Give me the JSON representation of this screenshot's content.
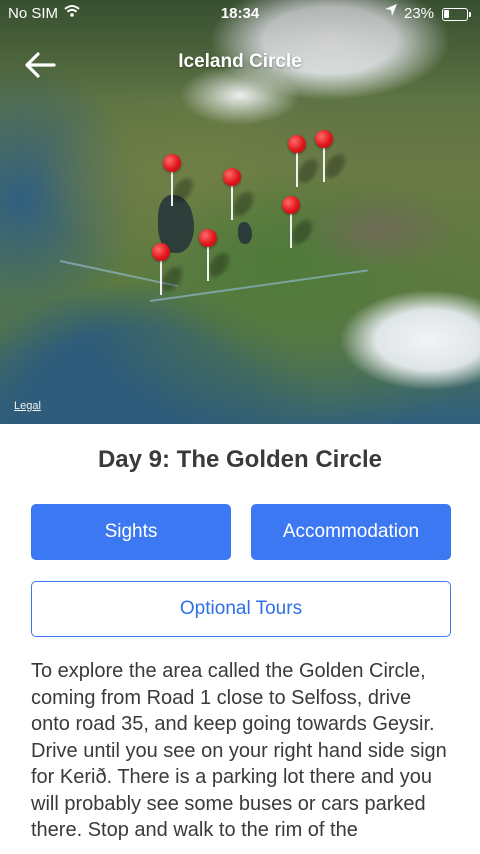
{
  "status_bar": {
    "carrier": "No SIM",
    "wifi_icon": "wifi-icon",
    "time": "18:34",
    "location_icon": "location-arrow-icon",
    "battery_percent": "23%",
    "battery_level": 0.23
  },
  "nav": {
    "back_icon": "arrow-left-icon",
    "title": "Iceland Circle"
  },
  "map": {
    "legal_label": "Legal",
    "pin_color": "#e0161b",
    "pin_count": 7
  },
  "day": {
    "title": "Day 9: The Golden Circle"
  },
  "buttons": {
    "sights": "Sights",
    "accommodation": "Accommodation",
    "optional_tours": "Optional Tours",
    "accent_color": "#3b78f2"
  },
  "description": "To explore the area called the Golden Circle, coming from Road 1 close to Selfoss, drive onto road 35, and keep going towards Geysir. Drive until you see on your right hand side sign for Kerið. There is a parking lot there and you will probably see some buses or cars parked there. Stop and walk to the rim of the"
}
